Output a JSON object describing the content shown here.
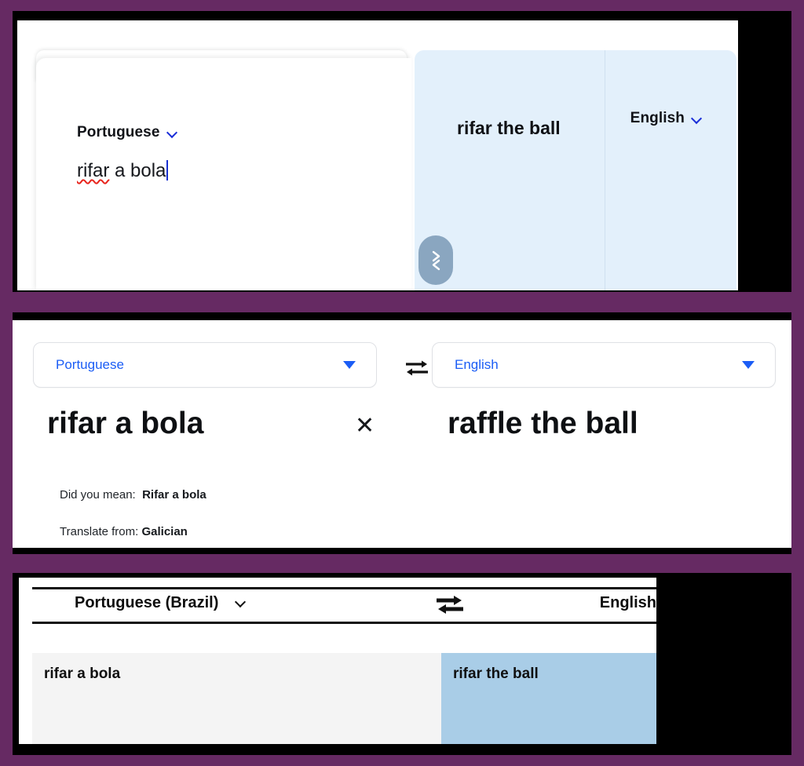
{
  "colors": {
    "frame_purple": "#662a63",
    "backdrop_black": "#000000",
    "accent_blue": "#1b5df5",
    "chevron_blue": "#1a2ed8",
    "target_panel_blue": "#e3f0fb",
    "handle_blue_gray": "#8aa6c0",
    "cell_highlight_blue": "#a9cde7",
    "cell_source_gray": "#f4f4f4",
    "spellcheck_red": "#e8261e"
  },
  "panel_top": {
    "source_language": "Portuguese",
    "source_text": "rifar a bola",
    "target_language": "English",
    "target_text": "rifar the ball",
    "chevron_icon": "chevron-down-icon",
    "handle_icon": "expand-handle-icon",
    "caret_visible": true,
    "spellcheck_word": "rifar"
  },
  "panel_middle": {
    "source_language": "Portuguese",
    "target_language": "English",
    "swap_icon": "swap-languages-icon",
    "dropdown_icon": "triangle-down-icon",
    "source_text": "rifar a bola",
    "target_text": "raffle the ball",
    "clear_icon": "close-icon",
    "clear_glyph": "✕",
    "did_you_mean_label": "Did you mean:",
    "did_you_mean_value": "Rifar a bola",
    "translate_from_label": "Translate from:",
    "translate_from_value": "Galician"
  },
  "panel_bottom": {
    "source_language": "Portuguese (Brazil)",
    "target_language": "English",
    "chevron_icon": "chevron-down-icon",
    "swap_icon": "swap-languages-icon",
    "source_text": "rifar a bola",
    "target_text": "rifar the ball"
  }
}
